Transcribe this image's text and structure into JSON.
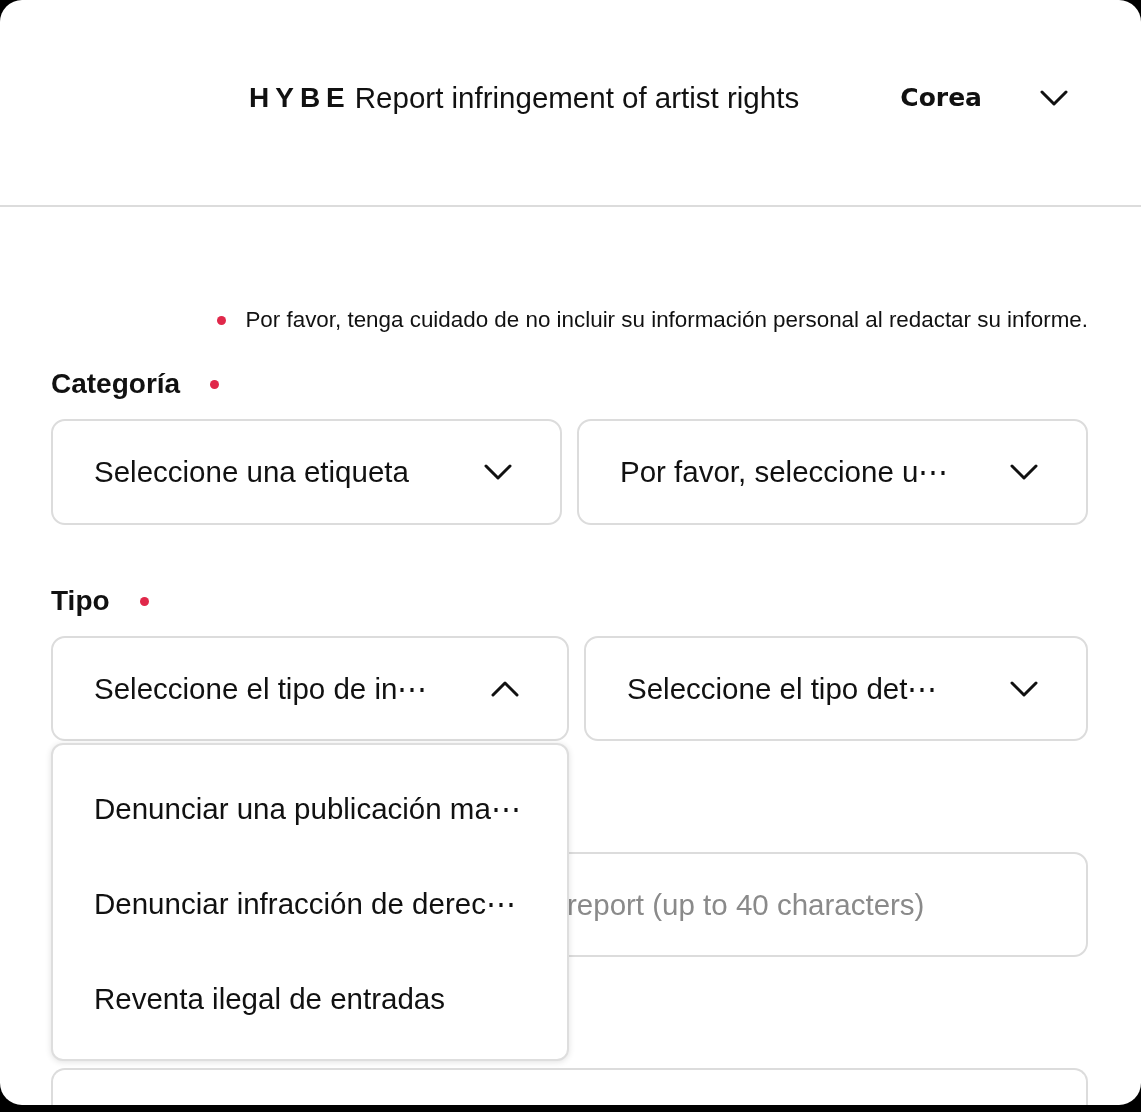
{
  "header": {
    "logo": "HYBE",
    "title": "Report infringement of artist rights",
    "region": "Corea"
  },
  "notice": "Por favor, tenga cuidado de no incluir su información personal al redactar su informe.",
  "fields": [
    {
      "label": "Categoría",
      "required": true,
      "selects": [
        {
          "text": "Seleccione una etiqueta",
          "expanded": false
        },
        {
          "text": "Por favor, seleccione u⋯",
          "expanded": false
        }
      ]
    },
    {
      "label": "Tipo",
      "required": true,
      "selects": [
        {
          "text": "Seleccione el tipo de in⋯",
          "expanded": true,
          "options": [
            "Denunciar una publicación ma⋯",
            "Denunciar infracción de derec⋯",
            "Reventa ilegal de entradas"
          ]
        },
        {
          "text": "Seleccione el tipo det⋯",
          "expanded": false
        }
      ]
    }
  ],
  "title_field": {
    "placeholder": "report (up to 40 characters)"
  }
}
